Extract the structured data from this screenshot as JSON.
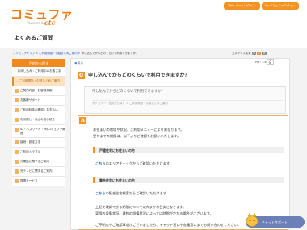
{
  "header": {
    "logo_text": "コミュファ",
    "logo_sub": "Powered by",
    "logo_brand": "ctc",
    "btn_web_mail": "Web メールログイン",
    "btn_my_commufa": "Myコミュファログイン"
  },
  "page_title": "よくあるご質問",
  "breadcrumb": {
    "items": [
      "コミュファトップ",
      "ご利用開始・引越まとめご案内"
    ],
    "current": "申し込んでからどのくらいで利用できますか？"
  },
  "font_size": {
    "label": "文字サイズ変更",
    "small": "小",
    "medium": "中",
    "large": "大"
  },
  "sidebar": {
    "header": "目的から探す",
    "items": [
      {
        "label": "お申し込み・ご利用中のお客さま"
      },
      {
        "label": "ご利用開始・引越まとめご案内"
      },
      {
        "label": "ご契約内容・お客様情報"
      },
      {
        "label": "お客様サポート"
      },
      {
        "label": "ご利用料金の確認・お支払い"
      },
      {
        "label": "お引越し・休止の各手続き"
      },
      {
        "label": "ID・パスワード・Myコミュファ関連"
      },
      {
        "label": "接続・設定方法"
      },
      {
        "label": "ご利用トラブル"
      },
      {
        "label": "光電話に関するご案内"
      },
      {
        "label": "光テレビに関するご案内"
      },
      {
        "label": "提携サービス"
      }
    ]
  },
  "back_label": "戻る",
  "page_id": "Pal：158",
  "print_icon": "printer-icon",
  "question": {
    "badge": "Q",
    "title": "申し込んでからどのくらいで利用できますか？",
    "body": "申し込んでからどのくらいで利用できますか？",
    "category": "カテゴリー：目的から探す ＞ ご利用開始・引越まとめご案内"
  },
  "answer": {
    "badge": "A",
    "line1": "お住まいの地域や状況、ご利用メニューにより異なります。",
    "line2": "受付までの期間は、以下よりご確認をお願いいたします。",
    "sec1": "戸建住宅にお住まいの方",
    "link1": "こちら",
    "sec1_text": "のエリアチェックからご確認いただけます",
    "sec2": "集合住宅にお住まいの方",
    "link2": "こちら",
    "sec2_text": "の集合住宅検索からご確認いただけます",
    "p3_line1": "上記で確認できる期間については大まかな目安となります。",
    "p3_line2": "実際の設備状況、建物の設備状況によっては時間がかかる場合がございます。",
    "p4": "ご不明点やご確認事項がございましたら、チャット窓口や各種窓口までお問い合わせください。"
  },
  "chat_button": "チャットサポート",
  "colors": {
    "brand_orange": "#f39322",
    "link_blue": "#2a62c4",
    "chat_blue": "#6b7fb9"
  }
}
